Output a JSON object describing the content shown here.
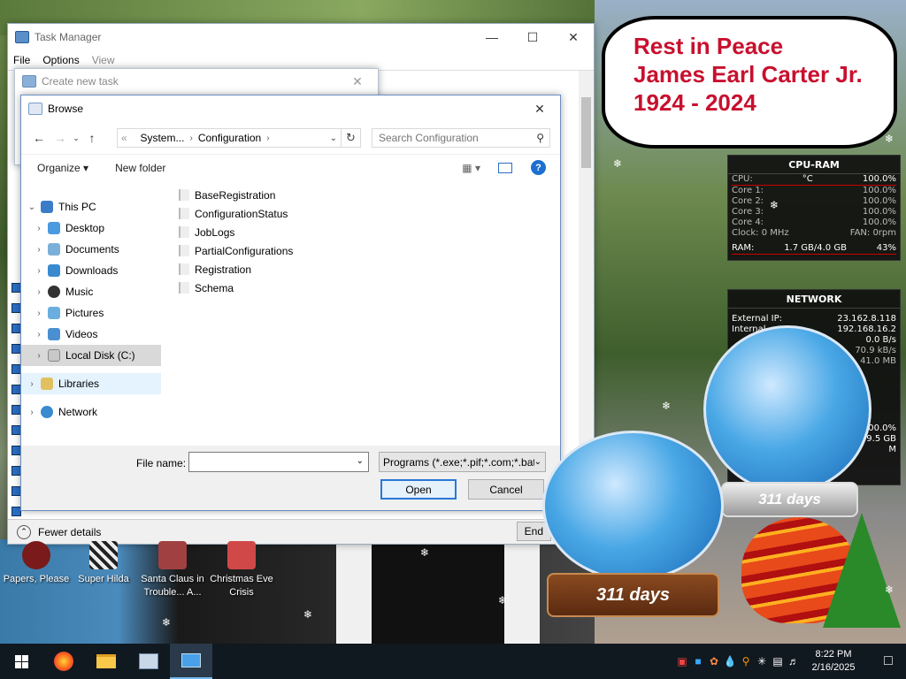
{
  "bubble": {
    "lines": [
      "Rest in Peace",
      "James Earl Carter Jr.",
      "1924 - 2024"
    ]
  },
  "cpu_gadget": {
    "title": "CPU-RAM",
    "rows": [
      {
        "label": "CPU:",
        "mid": "°C",
        "value": "100.0%"
      },
      {
        "label": "Core 1:",
        "value": "100.0%"
      },
      {
        "label": "Core 2:",
        "value": "100.0%"
      },
      {
        "label": "Core 3:",
        "value": "100.0%"
      },
      {
        "label": "Core 4:",
        "value": "100.0%"
      },
      {
        "label": "Clock: 0 MHz",
        "value": "FAN: 0rpm"
      },
      {
        "label": "RAM:",
        "mid": "1.7 GB/4.0 GB",
        "value": "43%"
      }
    ]
  },
  "net_gadget": {
    "title": "NETWORK",
    "rows": [
      {
        "label": "External IP:",
        "value": "23.162.8.118"
      },
      {
        "label": "Internal",
        "value": "192.168.16.2"
      },
      {
        "label": "",
        "value": "0.0 B/s"
      },
      {
        "label": "",
        "value": "70.9 kB/s"
      },
      {
        "label": "",
        "value": "41.0 MB"
      }
    ],
    "lower": [
      {
        "label": "",
        "value": "100.0%"
      },
      {
        "label": "",
        "value": "9.5 GB"
      },
      {
        "label": "",
        "value": "M"
      }
    ]
  },
  "task_manager": {
    "title": "Task Manager",
    "menu": [
      "File",
      "Options",
      "View"
    ],
    "fewer_details": "Fewer details",
    "end_task": "End"
  },
  "create_new_task": {
    "title": "Create new task"
  },
  "browse": {
    "title": "Browse",
    "path": [
      "«",
      "System...",
      "Configuration"
    ],
    "search_placeholder": "Search Configuration",
    "organize": "Organize ▾",
    "new_folder": "New folder",
    "tree": [
      {
        "label": "This PC",
        "expanded": true
      },
      {
        "label": "Desktop"
      },
      {
        "label": "Documents"
      },
      {
        "label": "Downloads"
      },
      {
        "label": "Music"
      },
      {
        "label": "Pictures"
      },
      {
        "label": "Videos"
      },
      {
        "label": "Local Disk (C:)"
      },
      {
        "label": "Libraries"
      },
      {
        "label": "Network"
      }
    ],
    "files": [
      "BaseRegistration",
      "ConfigurationStatus",
      "JobLogs",
      "PartialConfigurations",
      "Registration",
      "Schema"
    ],
    "file_name_label": "File name:",
    "file_name_value": "",
    "file_type": "Programs (*.exe;*.pif;*.com;*.bat",
    "open": "Open",
    "cancel": "Cancel"
  },
  "desktop_icons": [
    {
      "label": "Papers, Please"
    },
    {
      "label": "Super Hilda"
    },
    {
      "label": "Santa Claus in Trouble... A..."
    },
    {
      "label": "Christmas Eve Crisis"
    }
  ],
  "globes": {
    "left_days": "311 days",
    "right_days": "311 days"
  },
  "taskbar": {
    "time": "8:22 PM",
    "date": "2/16/2025"
  },
  "colors": {
    "accent": "#2a78d6",
    "bubble_text": "#c8102e",
    "taskbar": "#101820"
  }
}
